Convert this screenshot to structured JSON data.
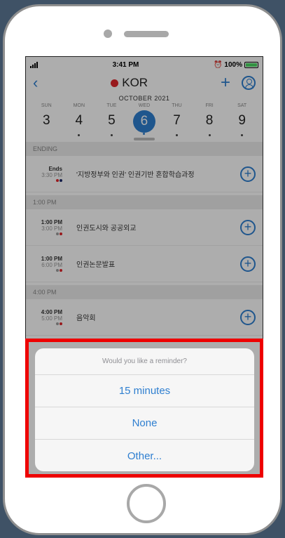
{
  "status_bar": {
    "time": "3:41 PM",
    "battery": "100%"
  },
  "header": {
    "title": "KOR"
  },
  "calendar": {
    "month": "OCTOBER 2021",
    "days": [
      {
        "name": "SUN",
        "num": "3"
      },
      {
        "name": "MON",
        "num": "4"
      },
      {
        "name": "TUE",
        "num": "5"
      },
      {
        "name": "WED",
        "num": "6"
      },
      {
        "name": "THU",
        "num": "7"
      },
      {
        "name": "FRI",
        "num": "8"
      },
      {
        "name": "SAT",
        "num": "9"
      }
    ],
    "selected_day": "6"
  },
  "sections": [
    {
      "label": "ENDING"
    },
    {
      "label": "1:00 PM"
    },
    {
      "label": "4:00 PM"
    }
  ],
  "events": [
    {
      "start": "Ends",
      "end": "3:30 PM",
      "title": "'지방정부와 인권' 인권기반 혼합학습과정",
      "dot_colors": [
        "#e0262b",
        "#1b2a6b"
      ]
    },
    {
      "start": "1:00 PM",
      "end": "3:00 PM",
      "title": "인권도시와 공공외교",
      "dot_colors": [
        "#9e9e9e",
        "#e0262b"
      ]
    },
    {
      "start": "1:00 PM",
      "end": "6:00 PM",
      "title": "인권논문발표",
      "dot_colors": [
        "#9e9e9e",
        "#e0262b"
      ]
    },
    {
      "start": "4:00 PM",
      "end": "5:00 PM",
      "title": "음악회",
      "dot_colors": [
        "#9e9e9e",
        "#e0262b"
      ]
    }
  ],
  "reminder_sheet": {
    "title": "Would you like a reminder?",
    "options": [
      "15 minutes",
      "None",
      "Other..."
    ]
  },
  "colors": {
    "accent": "#2f7fd0",
    "brand_red": "#e0262b",
    "highlight": "#ee0000"
  }
}
